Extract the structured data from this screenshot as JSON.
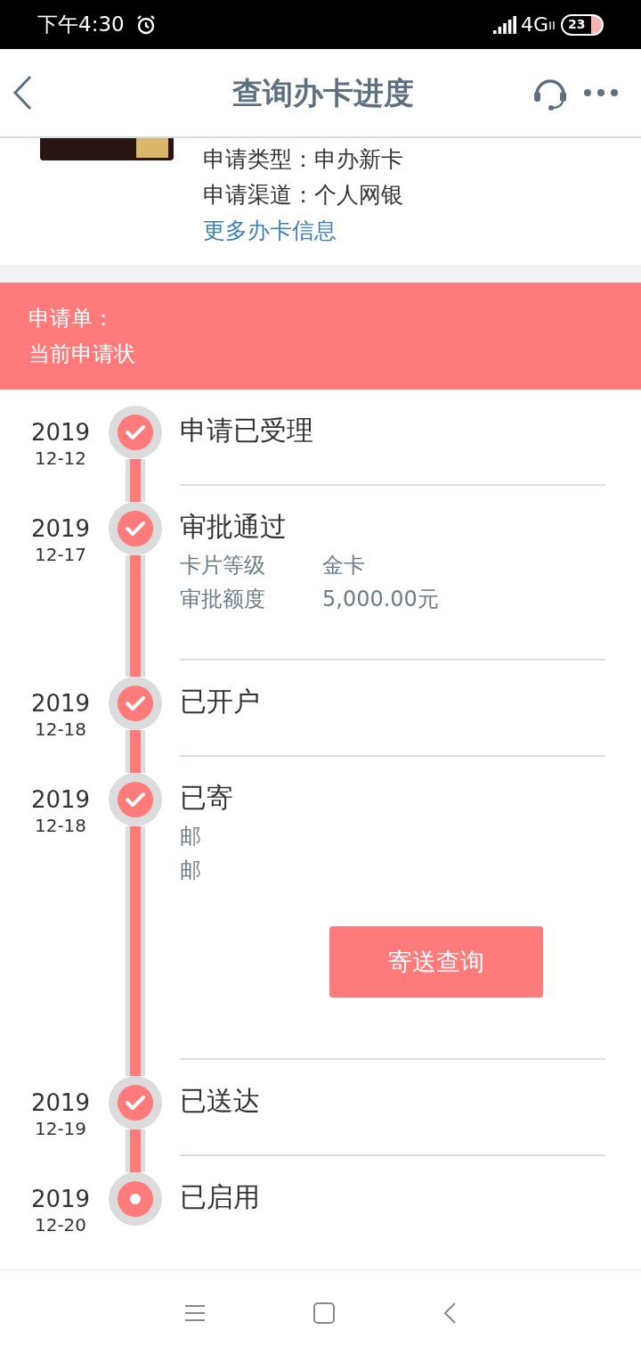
{
  "status_bar": {
    "time": "下午4:30",
    "network": "4G",
    "battery": "23"
  },
  "header": {
    "title": "查询办卡进度"
  },
  "card_info": {
    "lines": [
      {
        "label": "申请类型：",
        "value": "申办新卡"
      },
      {
        "label": "申请渠道：",
        "value": "个人网银"
      }
    ],
    "link": "更多办卡信息"
  },
  "banner": {
    "lines": [
      "申请单：",
      "当前申请状"
    ]
  },
  "timeline": [
    {
      "year": "2019",
      "date": "12-12",
      "title": "申请已受理",
      "done": true
    },
    {
      "year": "2019",
      "date": "12-17",
      "title": "审批通过",
      "done": true,
      "details": [
        {
          "label": "卡片等级",
          "value": "金卡"
        },
        {
          "label": "审批额度",
          "value": "5,000.00元"
        }
      ]
    },
    {
      "year": "2019",
      "date": "12-18",
      "title": "已开户",
      "done": true
    },
    {
      "year": "2019",
      "date": "12-18",
      "title": "已寄",
      "done": true,
      "details": [
        {
          "label": "邮"
        },
        {
          "label": "邮"
        }
      ],
      "button": "寄送查询"
    },
    {
      "year": "2019",
      "date": "12-19",
      "title": "已送达",
      "done": true
    },
    {
      "year": "2019",
      "date": "12-20",
      "title": "已启用",
      "done": false
    }
  ]
}
